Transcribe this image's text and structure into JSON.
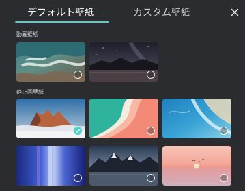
{
  "tabs": {
    "default_label": "デフォルト壁紙",
    "custom_label": "カスタム壁紙",
    "active": "default_label"
  },
  "close": {
    "icon": "close-icon"
  },
  "sections": {
    "video_label": "動画壁紙",
    "static_label": "静止画壁紙"
  },
  "video_wallpapers": [
    {
      "scene": "aerial-coast",
      "selected": false
    },
    {
      "scene": "night-lake-mountains",
      "selected": false
    }
  ],
  "static_wallpapers": [
    {
      "scene": "mountain-peaks-sunset",
      "selected": true
    },
    {
      "scene": "teal-pink-waves",
      "selected": false
    },
    {
      "scene": "blue-aerial-shore",
      "selected": false
    },
    {
      "scene": "blue-light-gradient",
      "selected": false
    },
    {
      "scene": "mountain-lake-night",
      "selected": false
    },
    {
      "scene": "pink-sunset-birds",
      "selected": false
    }
  ],
  "colors": {
    "background": "#2b2c30",
    "accent": "#4fd1c5",
    "tab_active_text": "#ffffff",
    "tab_inactive_text": "#c9cacd"
  }
}
